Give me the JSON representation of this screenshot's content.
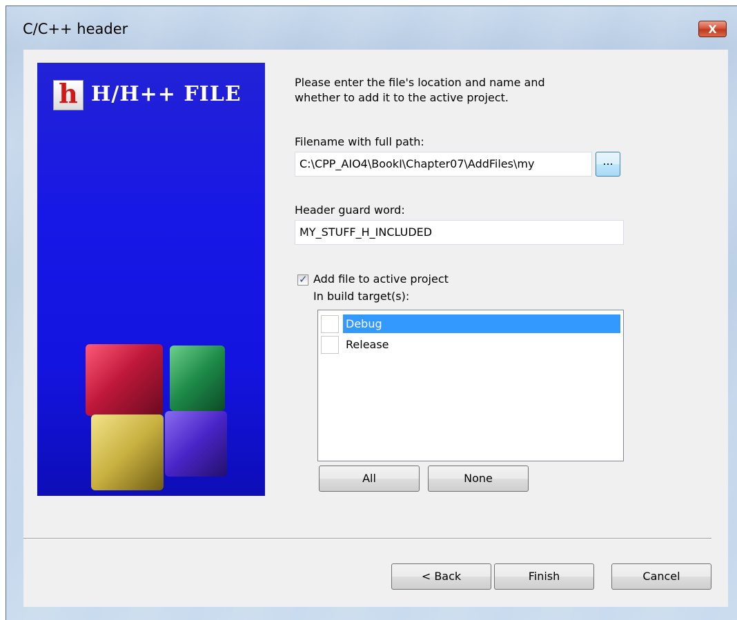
{
  "window": {
    "title": "C/C++ header",
    "close_label": "X"
  },
  "banner": {
    "logo_letter": "h",
    "caption": "H/H++ FILE"
  },
  "form": {
    "prompt_line1": "Please enter the file's location and name and",
    "prompt_line2": "whether to add it to the active project.",
    "filename_label": "Filename with full path:",
    "filename_value": "C:\\CPP_AIO4\\BookI\\Chapter07\\AddFiles\\my",
    "browse_label": "...",
    "guard_label": "Header guard word:",
    "guard_value": "MY_STUFF_H_INCLUDED",
    "add_to_project_label": "Add file to active project",
    "add_to_project_checked": true,
    "build_targets_label": "In build target(s):",
    "build_targets": [
      {
        "label": "Debug",
        "checked": false,
        "selected": true
      },
      {
        "label": "Release",
        "checked": false,
        "selected": false
      }
    ],
    "all_button": "All",
    "none_button": "None"
  },
  "footer": {
    "back_button": "< Back",
    "finish_button": "Finish",
    "cancel_button": "Cancel"
  },
  "colors": {
    "selection": "#3399ff",
    "banner_blue": "#1818e6",
    "close_red": "#c0391f"
  }
}
